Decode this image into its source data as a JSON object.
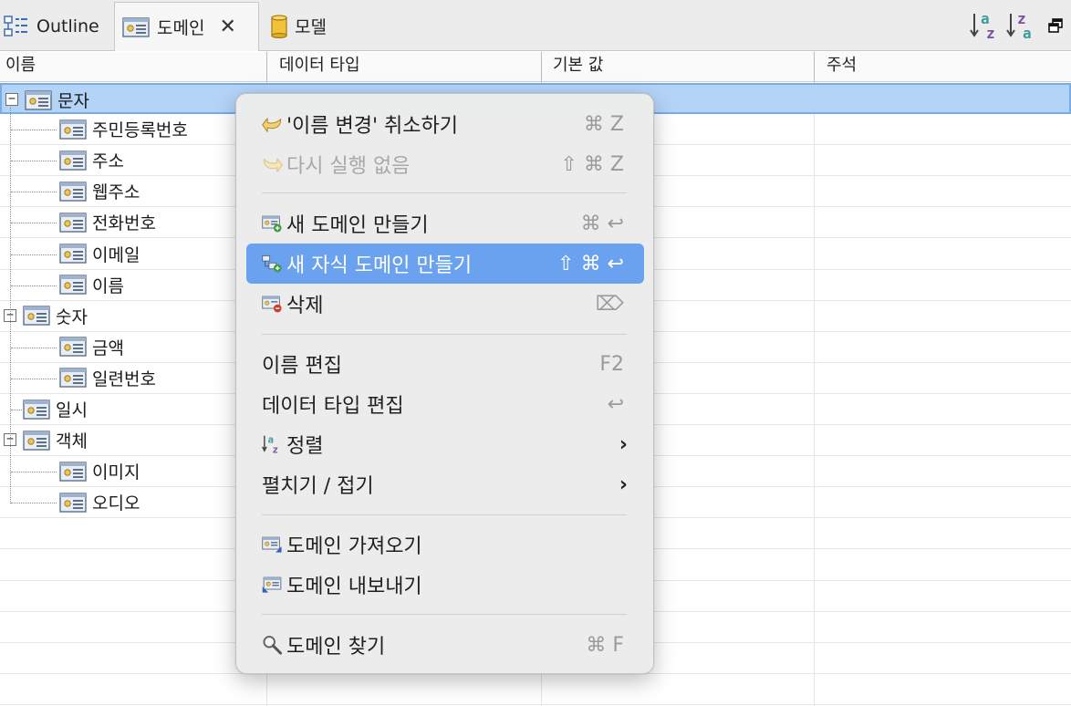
{
  "tabs": {
    "outline": "Outline",
    "domain": "도메인",
    "model": "모델"
  },
  "toolbar": {
    "sort_asc_icon": "sort-a-z-icon",
    "sort_desc_icon": "sort-z-a-icon",
    "restore_icon": "restore-window-icon"
  },
  "table": {
    "columns": [
      "이름",
      "데이터 타입",
      "기본 값",
      "주석"
    ],
    "rows": [
      {
        "label": "문자",
        "level": 0,
        "expander": "−",
        "selected": true
      },
      {
        "label": "주민등록번호",
        "level": 1
      },
      {
        "label": "주소",
        "level": 1
      },
      {
        "label": "웹주소",
        "level": 1
      },
      {
        "label": "전화번호",
        "level": 1
      },
      {
        "label": "이메일",
        "level": 1
      },
      {
        "label": "이름",
        "level": 1
      },
      {
        "label": "숫자",
        "level": 0,
        "expander": "−"
      },
      {
        "label": "금액",
        "level": 1
      },
      {
        "label": "일련번호",
        "level": 1
      },
      {
        "label": "일시",
        "level": 0
      },
      {
        "label": "객체",
        "level": 0,
        "expander": "−"
      },
      {
        "label": "이미지",
        "level": 1
      },
      {
        "label": "오디오",
        "level": 1
      }
    ]
  },
  "menu": {
    "undo": {
      "label": "'이름 변경' 취소하기",
      "shortcut": "⌘ Z"
    },
    "redo": {
      "label": "다시 실행 없음",
      "shortcut": "⇧ ⌘ Z"
    },
    "new_domain": {
      "label": "새 도메인 만들기",
      "shortcut": "⌘ ↩"
    },
    "new_child_domain": {
      "label": "새 자식 도메인 만들기",
      "shortcut": "⇧ ⌘ ↩"
    },
    "delete": {
      "label": "삭제",
      "shortcut": "⌦"
    },
    "rename": {
      "label": "이름 편집",
      "shortcut": "F2"
    },
    "edit_type": {
      "label": "데이터 타입 편집",
      "shortcut": "↩"
    },
    "sort": {
      "label": "정렬",
      "submenu_arrow": "›"
    },
    "expand_collapse": {
      "label": "펼치기 / 접기",
      "submenu_arrow": "›"
    },
    "import": {
      "label": "도메인 가져오기"
    },
    "export": {
      "label": "도메인 내보내기"
    },
    "find": {
      "label": "도메인 찾기",
      "shortcut": "⌘ F"
    }
  },
  "colors": {
    "selection": "#b3d3f7",
    "menu_highlight": "#6aa2ef"
  }
}
